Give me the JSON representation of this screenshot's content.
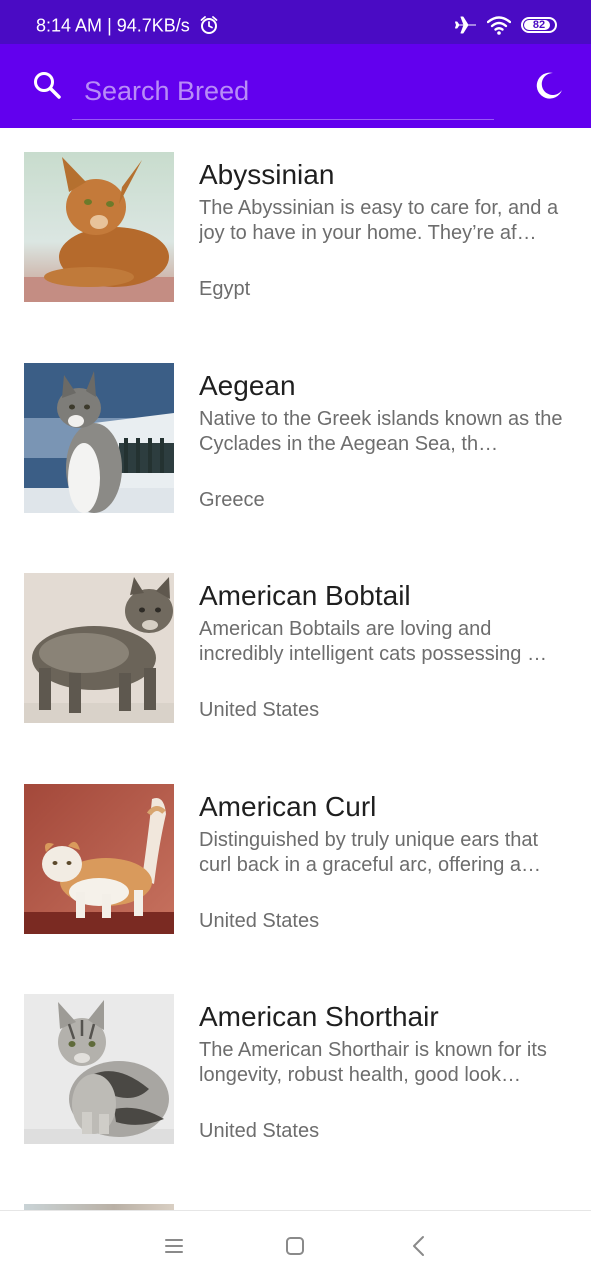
{
  "status_bar": {
    "time": "8:14 AM",
    "separator": "|",
    "network_speed": "94.7KB/s",
    "battery_level": "82",
    "icons": [
      "alarm-icon",
      "airplane-mode-icon",
      "wifi-icon",
      "battery-icon"
    ]
  },
  "app_bar": {
    "search_placeholder": "Search Breed",
    "search_value": "",
    "icons": [
      "search-icon",
      "dark-mode-moon-icon"
    ],
    "accent_color": "#6200ee",
    "status_color": "#4a0bc4"
  },
  "breeds": [
    {
      "name": "Abyssinian",
      "description": "The Abyssinian is easy to care for, and a joy to have in your home. They’re af…",
      "origin": "Egypt"
    },
    {
      "name": "Aegean",
      "description": "Native to the Greek islands known as the Cyclades in the Aegean Sea, th…",
      "origin": "Greece"
    },
    {
      "name": "American Bobtail",
      "description": "American Bobtails are loving and incredibly intelligent cats possessing …",
      "origin": "United States"
    },
    {
      "name": "American Curl",
      "description": "Distinguished by truly unique ears that curl back in a graceful arc, offering a…",
      "origin": "United States"
    },
    {
      "name": "American Shorthair",
      "description": "The American Shorthair is known for its longevity, robust health, good look…",
      "origin": "United States"
    }
  ],
  "nav_bar": {
    "icons": [
      "menu-icon",
      "home-square-icon",
      "back-chevron-icon"
    ]
  }
}
